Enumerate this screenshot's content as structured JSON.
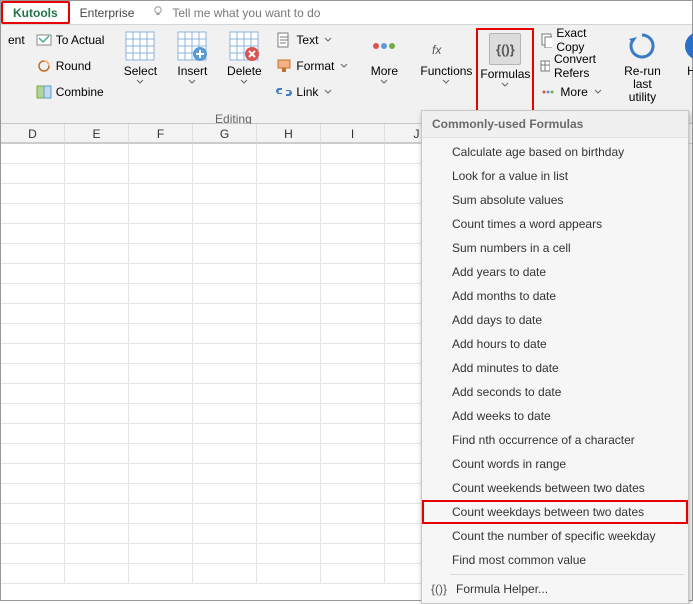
{
  "tabs": {
    "kutools": "Kutools",
    "enterprise": "Enterprise",
    "tellme": "Tell me what you want to do"
  },
  "ribbon": {
    "ent": "ent",
    "toactual": "To Actual",
    "round": "Round",
    "combine": "Combine",
    "select": "Select",
    "insert": "Insert",
    "delete": "Delete",
    "text": "Text",
    "format": "Format",
    "link": "Link",
    "more": "More",
    "functions": "Functions",
    "formulas": "Formulas",
    "exactcopy": "Exact Copy",
    "convertrefers": "Convert Refers",
    "more2": "More",
    "rerun": "Re-run last utility",
    "help": "Help",
    "group_editing": "Editing"
  },
  "formula_glyph": "{()}",
  "columns": [
    "D",
    "E",
    "F",
    "G",
    "H",
    "I",
    "J"
  ],
  "dropdown": {
    "header": "Commonly-used Formulas",
    "items": [
      "Calculate age based on birthday",
      "Look for a value in list",
      "Sum absolute values",
      "Count times a word appears",
      "Sum numbers in a cell",
      "Add years to date",
      "Add months to date",
      "Add days to date",
      "Add hours to date",
      "Add minutes to date",
      "Add seconds to date",
      "Add weeks to date",
      "Find nth occurrence of a character",
      "Count words in range",
      "Count weekends between two dates",
      "Count weekdays between two dates",
      "Count the number of specific weekday",
      "Find most common value"
    ],
    "highlight_index": 15,
    "helper": "Formula Helper..."
  }
}
